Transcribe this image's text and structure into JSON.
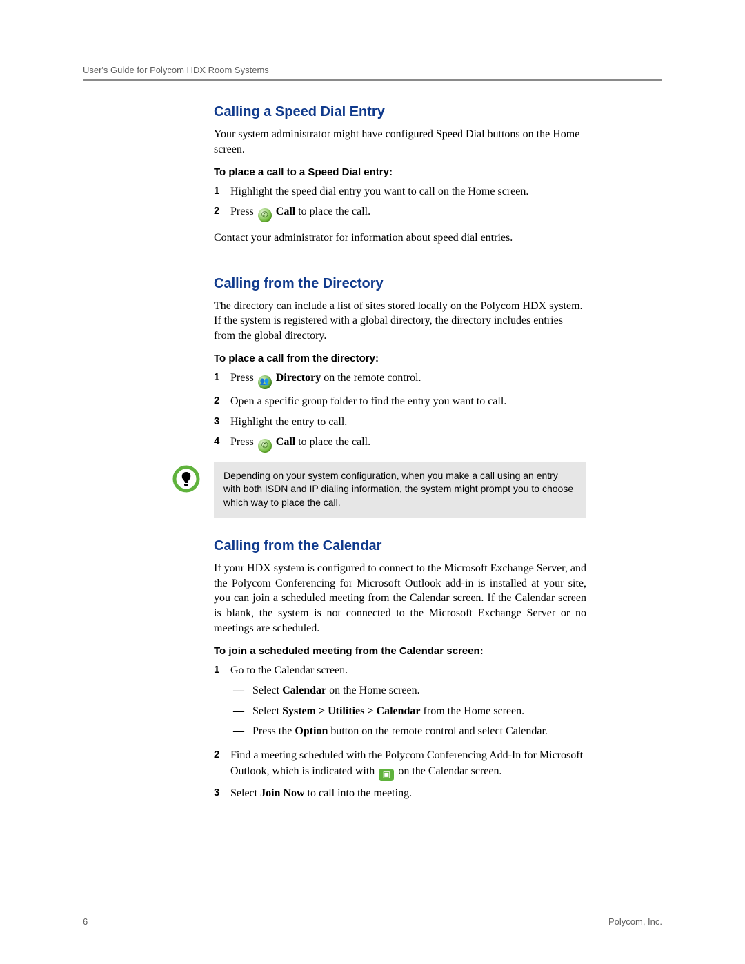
{
  "header": {
    "title": "User's Guide for Polycom HDX Room Systems"
  },
  "footer": {
    "page_number": "6",
    "company": "Polycom, Inc."
  },
  "s1": {
    "heading": "Calling a Speed Dial Entry",
    "intro": "Your system administrator might have configured Speed Dial buttons on the Home screen.",
    "sub": "To place a call to a Speed Dial entry:",
    "step1_num": "1",
    "step1": "Highlight the speed dial entry you want to call on the Home screen.",
    "step2_num": "2",
    "step2_a": "Press ",
    "step2_b_bold": "Call",
    "step2_c": " to place the call.",
    "after": "Contact your administrator for information about speed dial entries."
  },
  "s2": {
    "heading": "Calling from the Directory",
    "intro": "The directory can include a list of sites stored locally on the Polycom HDX system. If the system is registered with a global directory, the directory includes entries from the global directory.",
    "sub": "To place a call from the directory:",
    "step1_num": "1",
    "step1_a": "Press ",
    "step1_b_bold": "Directory",
    "step1_c": " on the remote control.",
    "step2_num": "2",
    "step2": "Open a specific group folder to find the entry you want to call.",
    "step3_num": "3",
    "step3": "Highlight the entry to call.",
    "step4_num": "4",
    "step4_a": "Press ",
    "step4_b_bold": "Call",
    "step4_c": " to place the call.",
    "note": "Depending on your system configuration, when you make a call using an entry with both ISDN and IP dialing information, the system might prompt you to choose which way to place the call."
  },
  "s3": {
    "heading": "Calling from the Calendar",
    "intro": "If your HDX system is configured to connect to the Microsoft Exchange Server, and the Polycom Conferencing for Microsoft Outlook add-in is installed at your site, you can join a scheduled meeting from the Calendar screen. If the Calendar screen is blank, the system is not connected to the Microsoft Exchange Server or no meetings are scheduled.",
    "sub": "To join a scheduled meeting from the Calendar screen:",
    "step1_num": "1",
    "step1": "Go to the Calendar screen.",
    "dash1_a": "Select ",
    "dash1_b_bold": "Calendar",
    "dash1_c": " on the Home screen.",
    "dash2_a": "Select ",
    "dash2_b_bold": "System > Utilities > Calendar",
    "dash2_c": " from the Home screen.",
    "dash3_a": "Press the ",
    "dash3_b_bold": "Option",
    "dash3_c": " button on the remote control and select Calendar.",
    "step2_num": "2",
    "step2_a": "Find a meeting scheduled with the Polycom Conferencing Add-In for Microsoft Outlook, which is indicated with ",
    "step2_c": " on the Calendar screen.",
    "step3_num": "3",
    "step3_a": "Select ",
    "step3_b_bold": "Join Now",
    "step3_c": " to call into the meeting."
  },
  "icons": {
    "call": "call-icon",
    "directory": "directory-icon",
    "meeting": "meeting-icon",
    "tip": "tip-icon"
  }
}
